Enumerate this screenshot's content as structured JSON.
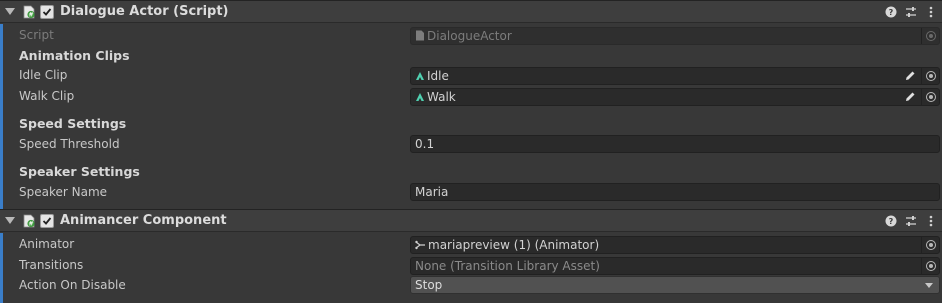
{
  "components": [
    {
      "title": "Dialogue Actor (Script)",
      "script": {
        "label": "Script",
        "value": "DialogueActor"
      },
      "sections": [
        {
          "heading": "Animation Clips"
        },
        {
          "heading": "Speed Settings"
        },
        {
          "heading": "Speaker Settings"
        }
      ],
      "fields": {
        "idle_clip": {
          "label": "Idle Clip",
          "value": "Idle"
        },
        "walk_clip": {
          "label": "Walk Clip",
          "value": "Walk"
        },
        "speed_threshold": {
          "label": "Speed Threshold",
          "value": "0.1"
        },
        "speaker_name": {
          "label": "Speaker Name",
          "value": "Maria"
        }
      }
    },
    {
      "title": "Animancer Component",
      "fields": {
        "animator": {
          "label": "Animator",
          "value": "mariapreview (1) (Animator)"
        },
        "transitions": {
          "label": "Transitions",
          "value": "None (Transition Library Asset)"
        },
        "action_on_disable": {
          "label": "Action On Disable",
          "value": "Stop"
        }
      }
    }
  ],
  "icons": {
    "foldout": "triangle-down-icon",
    "script": "csharp-script-icon",
    "help": "help-icon",
    "presets": "sliders-icon",
    "menu": "kebab-menu-icon",
    "clip": "animation-clip-icon",
    "pencil": "pencil-icon",
    "object_picker": "object-picker-icon",
    "animator": "animator-icon"
  },
  "colors": {
    "accent_bar": "#3a7ec9",
    "clip_icon": "#4fd0b0"
  }
}
